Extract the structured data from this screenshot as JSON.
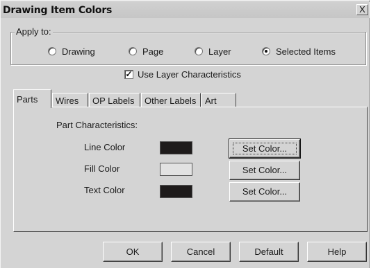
{
  "window": {
    "title": "Drawing Item Colors",
    "close_glyph": "X"
  },
  "apply_to": {
    "legend": "Apply to:",
    "options": [
      {
        "label": "Drawing",
        "selected": false
      },
      {
        "label": "Page",
        "selected": false
      },
      {
        "label": "Layer",
        "selected": false
      },
      {
        "label": "Selected Items",
        "selected": true
      }
    ]
  },
  "use_layer": {
    "label": "Use Layer Characteristics",
    "checked": true,
    "check_glyph": "✓"
  },
  "tabs": [
    {
      "label": "Parts",
      "active": true
    },
    {
      "label": "Wires",
      "active": false
    },
    {
      "label": "OP Labels",
      "active": false
    },
    {
      "label": "Other Labels",
      "active": false
    },
    {
      "label": "Art",
      "active": false
    }
  ],
  "parts": {
    "heading": "Part Characteristics:",
    "rows": [
      {
        "label": "Line Color",
        "color": "#1e1b1b",
        "button": "Set Color..."
      },
      {
        "label": "Fill Color",
        "color": "#e2e2e2",
        "button": "Set Color..."
      },
      {
        "label": "Text Color",
        "color": "#1e1b1b",
        "button": "Set Color..."
      }
    ]
  },
  "footer": {
    "ok": "OK",
    "cancel": "Cancel",
    "default": "Default",
    "help": "Help"
  }
}
